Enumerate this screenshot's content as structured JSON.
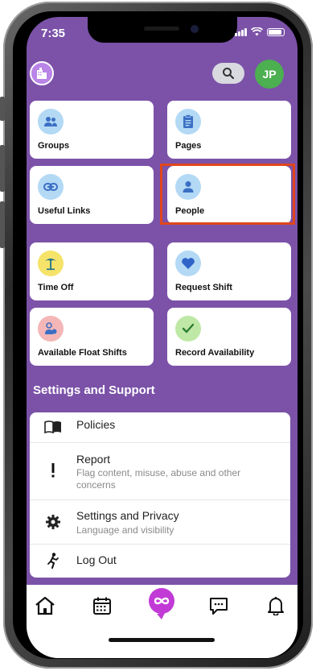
{
  "status": {
    "time": "7:35"
  },
  "header": {
    "logo_icon": "building-icon",
    "search_icon": "search-icon",
    "avatar_initials": "JP"
  },
  "tiles": [
    {
      "id": "groups",
      "label": "Groups",
      "icon": "groups-icon",
      "icon_bg": "#b3d9f5"
    },
    {
      "id": "pages",
      "label": "Pages",
      "icon": "clipboard-icon",
      "icon_bg": "#b3d9f5"
    },
    {
      "id": "useful-links",
      "label": "Useful Links",
      "icon": "link-icon",
      "icon_bg": "#b3d9f5"
    },
    {
      "id": "people",
      "label": "People",
      "icon": "person-icon",
      "icon_bg": "#b3d9f5"
    },
    {
      "id": "time-off",
      "label": "Time Off",
      "icon": "palm-tree-icon",
      "icon_bg": "#f5e36a"
    },
    {
      "id": "request-shift",
      "label": "Request Shift",
      "icon": "heart-icon",
      "icon_bg": "#b3d9f5"
    },
    {
      "id": "available-float-shifts",
      "label": "Available Float Shifts",
      "icon": "float-person-icon",
      "icon_bg": "#f4b6b6"
    },
    {
      "id": "record-availability",
      "label": "Record Availability",
      "icon": "check-icon",
      "icon_bg": "#bfe8a6"
    }
  ],
  "settings": {
    "title": "Settings and Support",
    "items": [
      {
        "title": "Policies",
        "subtitle": "",
        "icon": "book-icon"
      },
      {
        "title": "Report",
        "subtitle": "Flag content, misuse, abuse and other concerns",
        "icon": "exclamation-icon"
      },
      {
        "title": "Settings and Privacy",
        "subtitle": "Language and visibility",
        "icon": "gear-icon"
      },
      {
        "title": "Log Out",
        "subtitle": "",
        "icon": "running-person-icon"
      }
    ]
  },
  "tabbar": [
    "home-icon",
    "calendar-icon",
    "infinity-icon",
    "chat-icon",
    "bell-icon"
  ],
  "colors": {
    "background": "#7b52a8",
    "accent": "#c13ad6",
    "highlight": "#e0461c",
    "avatar": "#4caf50"
  }
}
